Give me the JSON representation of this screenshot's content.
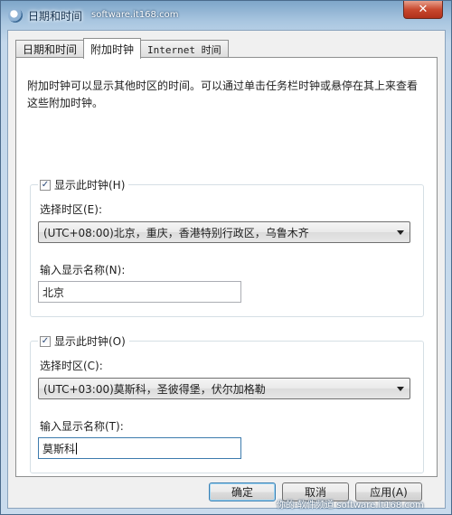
{
  "window": {
    "title": "日期和时间",
    "close_label": "✕"
  },
  "watermarks": {
    "top": "software.it168.com",
    "bottom": "你的·软件频道  software.it168.com"
  },
  "tabs": [
    {
      "label": "日期和时间"
    },
    {
      "label": "附加时钟"
    },
    {
      "label": "Internet 时间"
    }
  ],
  "panel": {
    "description": "附加时钟可以显示其他时区的时间。可以通过单击任务栏时钟或悬停在其上来查看这些附加时钟。"
  },
  "clock1": {
    "show_label": "显示此时钟(H)",
    "checked": true,
    "timezone_label": "选择时区(E):",
    "timezone_value": "(UTC+08:00)北京，重庆，香港特别行政区，乌鲁木齐",
    "name_label": "输入显示名称(N):",
    "name_value": "北京"
  },
  "clock2": {
    "show_label": "显示此时钟(O)",
    "checked": true,
    "timezone_label": "选择时区(C):",
    "timezone_value": "(UTC+03:00)莫斯科，圣彼得堡，伏尔加格勒",
    "name_label": "输入显示名称(T):",
    "name_value": "莫斯科"
  },
  "buttons": {
    "ok": "确定",
    "cancel": "取消",
    "apply": "应用(A)"
  }
}
